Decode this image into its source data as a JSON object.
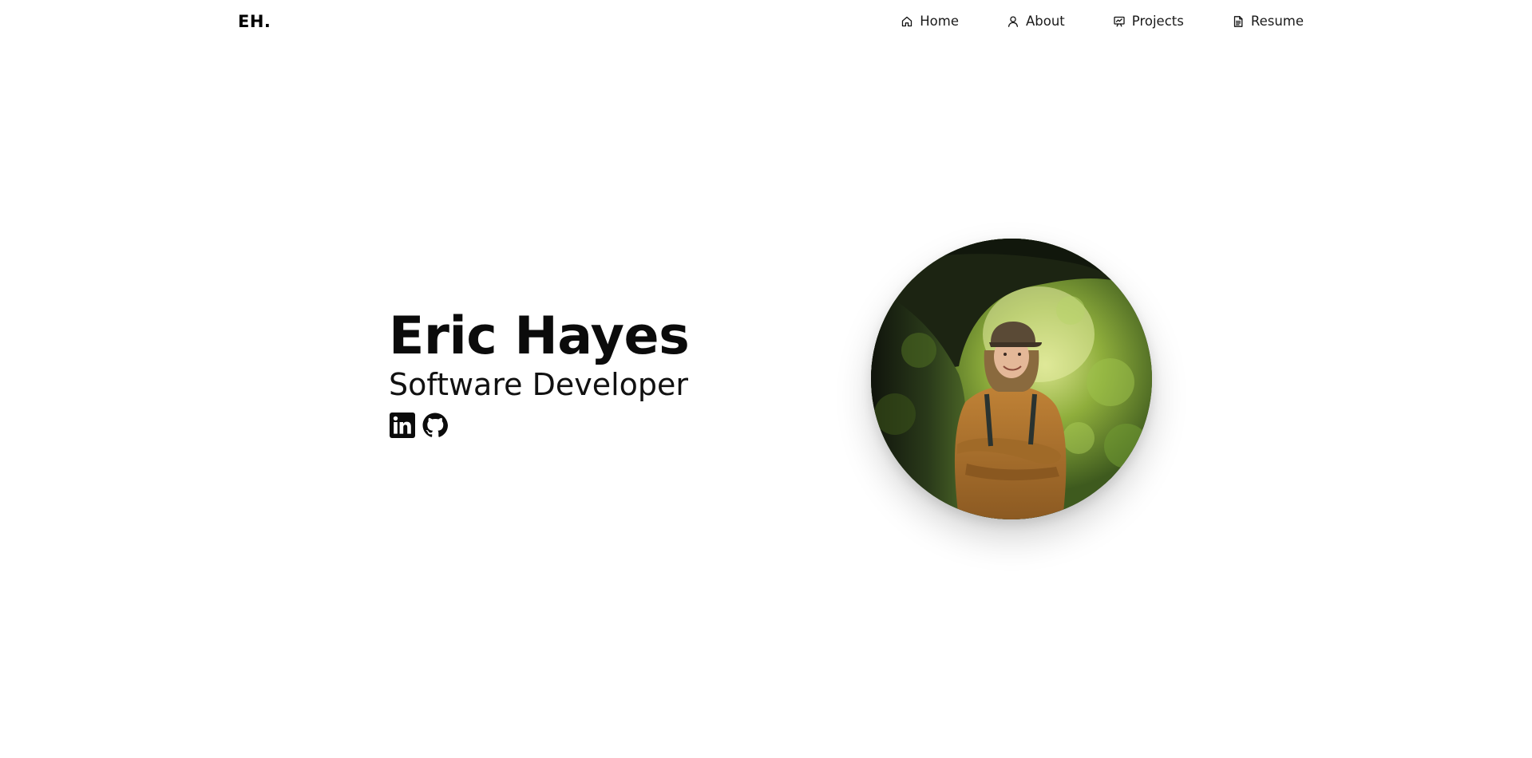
{
  "brand": {
    "logo_text": "EH."
  },
  "nav": {
    "items": [
      {
        "label": "Home",
        "icon": "home-icon"
      },
      {
        "label": "About",
        "icon": "user-icon"
      },
      {
        "label": "Projects",
        "icon": "presentation-icon"
      },
      {
        "label": "Resume",
        "icon": "document-icon"
      }
    ]
  },
  "hero": {
    "name": "Eric Hayes",
    "role": "Software Developer",
    "socials": [
      {
        "icon": "linkedin-icon"
      },
      {
        "icon": "github-icon"
      }
    ],
    "avatar": {
      "icon": "profile-photo"
    }
  }
}
